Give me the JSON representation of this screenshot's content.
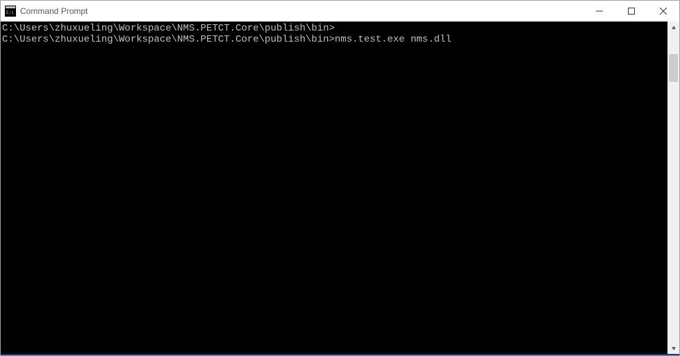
{
  "window": {
    "title": "Command Prompt"
  },
  "terminal": {
    "lines": [
      {
        "prompt": "C:\\Users\\zhuxueling\\Workspace\\NMS.PETCT.Core\\publish\\bin>",
        "command": ""
      },
      {
        "prompt": "C:\\Users\\zhuxueling\\Workspace\\NMS.PETCT.Core\\publish\\bin>",
        "command": "nms.test.exe nms.dll"
      }
    ]
  }
}
